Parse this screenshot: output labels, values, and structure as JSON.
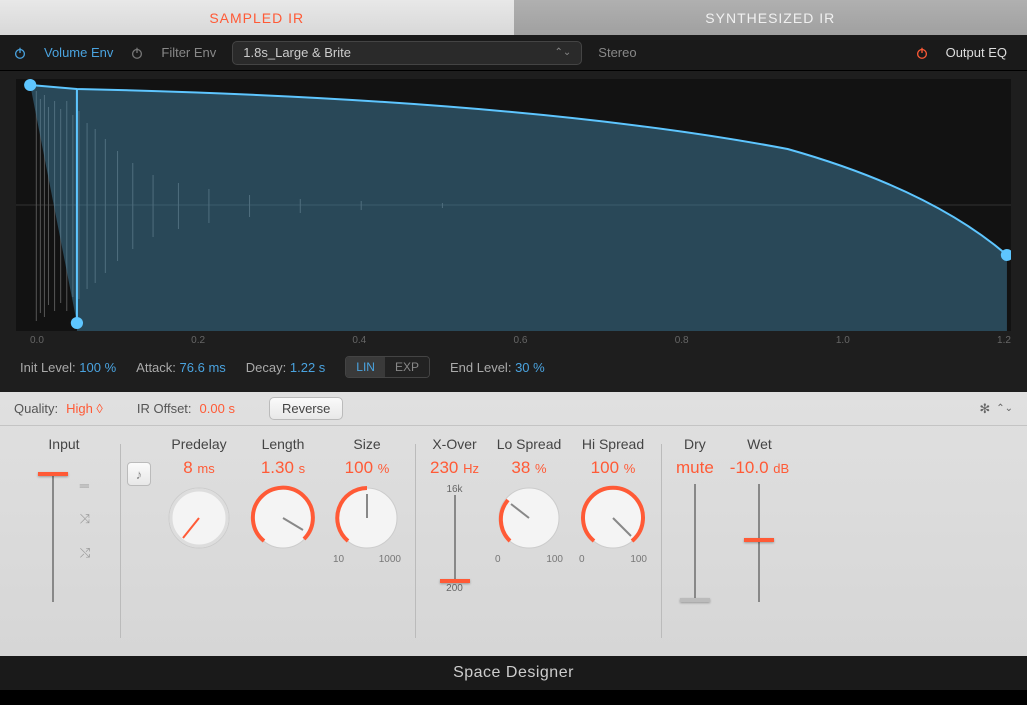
{
  "tabs": {
    "sampled": "SAMPLED IR",
    "synth": "SYNTHESIZED IR"
  },
  "toolbar": {
    "volume_env": "Volume Env",
    "filter_env": "Filter Env",
    "preset": "1.8s_Large & Brite",
    "stereo": "Stereo",
    "output_eq": "Output EQ"
  },
  "axis": [
    "0.0",
    "0.2",
    "0.4",
    "0.6",
    "0.8",
    "1.0",
    "1.2"
  ],
  "env": {
    "init_label": "Init Level:",
    "init_val": "100 %",
    "attack_label": "Attack:",
    "attack_val": "76.6 ms",
    "decay_label": "Decay:",
    "decay_val": "1.22 s",
    "lin": "LIN",
    "exp": "EXP",
    "end_label": "End Level:",
    "end_val": "30 %"
  },
  "panel_top": {
    "quality_label": "Quality:",
    "quality_val": "High ◊",
    "offset_label": "IR Offset:",
    "offset_val": "0.00 s",
    "reverse": "Reverse"
  },
  "input": {
    "title": "Input"
  },
  "predelay": {
    "title": "Predelay",
    "val": "8",
    "unit": "ms"
  },
  "length": {
    "title": "Length",
    "val": "1.30",
    "unit": "s"
  },
  "size": {
    "title": "Size",
    "val": "100",
    "unit": "%",
    "lo": "10",
    "hi": "1000"
  },
  "xover": {
    "title": "X-Over",
    "val": "230",
    "unit": "Hz",
    "hi": "16k",
    "lo": "200"
  },
  "lospread": {
    "title": "Lo Spread",
    "val": "38",
    "unit": "%",
    "lo": "0",
    "hi": "100"
  },
  "hispread": {
    "title": "Hi Spread",
    "val": "100",
    "unit": "%",
    "lo": "0",
    "hi": "100"
  },
  "dry": {
    "title": "Dry",
    "val": "mute"
  },
  "wet": {
    "title": "Wet",
    "val": "-10.0",
    "unit": "dB"
  },
  "footer": "Space Designer",
  "colors": {
    "accent": "#ff5a36",
    "blue": "#4aa3df"
  }
}
